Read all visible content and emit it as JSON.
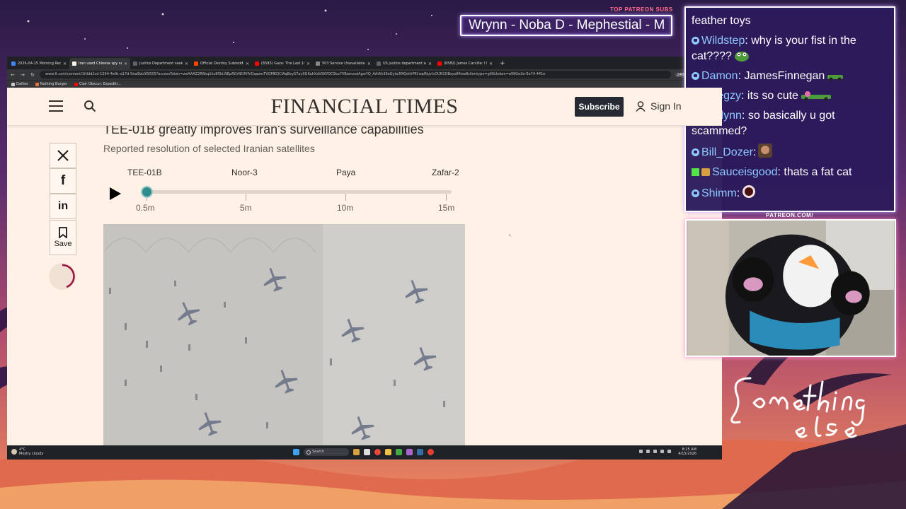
{
  "browser": {
    "tabs": [
      {
        "label": "2026-04-15 Morning Recap - G",
        "color": "#4285f4",
        "active": false
      },
      {
        "label": "Iran used Chinese spy satellite",
        "color": "#fff1e5",
        "active": true
      },
      {
        "label": "Justice Department seeks to tes",
        "color": "#5f6368",
        "active": false
      },
      {
        "label": "Official Destiny Subreddit",
        "color": "#ff4500",
        "active": false
      },
      {
        "label": "(6583) Gaza: The Last 100 Years",
        "color": "#ff0000",
        "active": false
      },
      {
        "label": "503 Service Unavailable",
        "color": "#888888",
        "active": false
      },
      {
        "label": "US justice department seeks to",
        "color": "#5f6368",
        "active": false
      },
      {
        "label": "(6582) James Carville: I Have Tr",
        "color": "#ff0000",
        "active": false
      }
    ],
    "new_tab": "+",
    "url": "www.ft.com/content/1fddd2cd-1294-4e9c-a17d-5ea0bb3f9555?accessToken=zwAAAZ2R6bq1kc8f3d.NEpROrNOfVfVGqazmTVQMEQCIAqBeyS7ay9GKahXdVSKYOC0bo7VBamzsdAgwYQ_AAiAh36eGyto3MQdrhFRf.wpRbjv.kOUN1OBsyo84ow8cfsmtype=gift&token=e99Ge2e-0e74-441e",
    "zoom": "240%",
    "bookmarks": [
      {
        "label": "Dailies",
        "color": "#cccccc"
      },
      {
        "label": "Nothing Burger",
        "color": "#e8703a"
      },
      {
        "label": "Clair Obscur: Expediti...",
        "color": "#ff0000"
      }
    ]
  },
  "ft": {
    "logo": "FINANCIAL TIMES",
    "subscribe": "Subscribe",
    "sign_in": "Sign In",
    "title": "TEE-01B greatly improves Iran's surveillance capabilities",
    "subtitle": "Reported resolution of selected Iranian satellites",
    "save_label": "Save",
    "slider_labels": [
      "TEE-01B",
      "Noor-3",
      "Paya",
      "Zafar-2"
    ],
    "tick_labels": [
      "0.5m",
      "5m",
      "10m",
      "15m"
    ],
    "slider_value": "0.5m"
  },
  "taskbar": {
    "weather_temp": "4°C",
    "weather_desc": "Mostly cloudy",
    "search_placeholder": "Search",
    "time": "8:25 AM",
    "date": "4/15/2026"
  },
  "overlay": {
    "patreon_subs_label": "TOP PATREON SUBS",
    "patreon_subs_marquee": "Wrynn -  Noba D - Mephestial - M",
    "patreon_url": "PATREON.COM/",
    "brand_logo": "Something else",
    "chat": [
      {
        "user": "",
        "text": "feather toys",
        "badge": "none",
        "emote": ""
      },
      {
        "user": "Wildstep",
        "text": ": why is your fist in the cat????",
        "badge": "circle",
        "emote": "pepe"
      },
      {
        "user": "Damon",
        "text": ": JamesFinnegan",
        "badge": "circle",
        "emote": "car"
      },
      {
        "user": "0Megzy",
        "text": ": its so cute",
        "badge": "circle",
        "emote": "car"
      },
      {
        "user": "Evelynn",
        "text": ": so basically u got scammed?",
        "badge": "circle",
        "emote": ""
      },
      {
        "user": "Bill_Dozer",
        "text": ":",
        "badge": "circle",
        "emote": "face"
      },
      {
        "user": "Sauceisgood",
        "text": ": thats a fat cat",
        "badge": "kick",
        "emote": ""
      },
      {
        "user": "Shimm",
        "text": ":",
        "badge": "circle",
        "emote": "ball"
      }
    ]
  },
  "colors": {
    "ft_background": "#fff1e5",
    "slider_thumb": "#2e8c8c",
    "chat_background": "#2c1a5c",
    "accent_pink": "#ff6a8a"
  }
}
